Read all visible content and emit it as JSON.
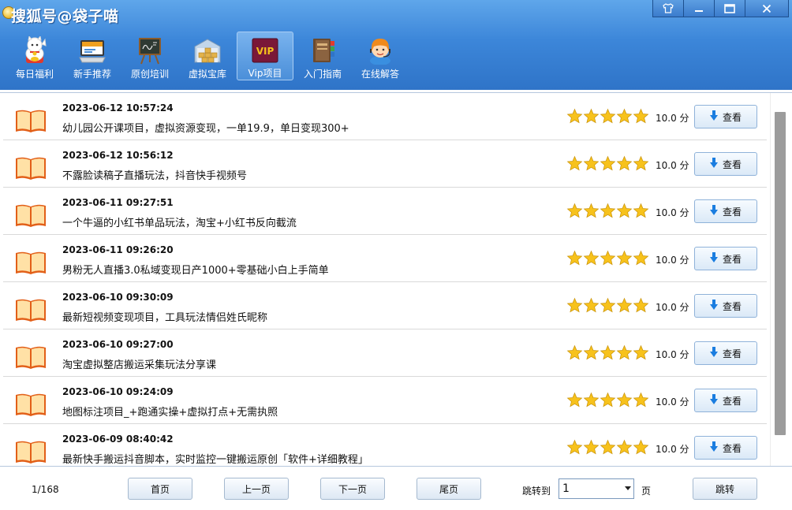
{
  "app": {
    "title": "搜狐号@袋子喵",
    "window_controls": [
      "skin-icon",
      "minimize-icon",
      "maximize-icon",
      "close-icon"
    ]
  },
  "toolbar": {
    "items": [
      {
        "label": "每日福利",
        "icon": "lucky-cat-icon"
      },
      {
        "label": "新手推荐",
        "icon": "monitor-icon"
      },
      {
        "label": "原创培训",
        "icon": "chalkboard-icon"
      },
      {
        "label": "虚拟宝库",
        "icon": "warehouse-icon"
      },
      {
        "label": "Vip项目",
        "icon": "vip-icon",
        "active": true
      },
      {
        "label": "入门指南",
        "icon": "books-icon"
      },
      {
        "label": "在线解答",
        "icon": "support-agent-icon"
      }
    ],
    "vip_badge": "VIP"
  },
  "list": {
    "view_label": "查看",
    "score_unit": "分",
    "items": [
      {
        "date": "2023-06-12 10:57:24",
        "title": "幼儿园公开课项目，虚拟资源变现，一单19.9，单日变现300+",
        "score": "10.0",
        "stars": 5
      },
      {
        "date": "2023-06-12 10:56:12",
        "title": "不露脸读稿子直播玩法，抖音快手视频号",
        "score": "10.0",
        "stars": 5
      },
      {
        "date": "2023-06-11 09:27:51",
        "title": "一个牛逼的小红书单品玩法，淘宝+小红书反向截流",
        "score": "10.0",
        "stars": 5
      },
      {
        "date": "2023-06-11 09:26:20",
        "title": "男粉无人直播3.0私域变现日产1000+零基础小白上手简单",
        "score": "10.0",
        "stars": 5
      },
      {
        "date": "2023-06-10 09:30:09",
        "title": "最新短视频变现项目，工具玩法情侣姓氏昵称",
        "score": "10.0",
        "stars": 5
      },
      {
        "date": "2023-06-10 09:27:00",
        "title": "淘宝虚拟整店搬运采集玩法分享课",
        "score": "10.0",
        "stars": 5
      },
      {
        "date": "2023-06-10 09:24:09",
        "title": "地图标注项目_+跑通实操+虚拟打点+无需执照",
        "score": "10.0",
        "stars": 5
      },
      {
        "date": "2023-06-09 08:40:42",
        "title": "最新快手搬运抖音脚本，实时监控一键搬运原创「软件+详细教程」",
        "score": "10.0",
        "stars": 5
      }
    ]
  },
  "pagination": {
    "page_count": "1/168",
    "first": "首页",
    "prev": "上一页",
    "next": "下一页",
    "last": "尾页",
    "jump_to": "跳转到",
    "page_value": "1",
    "page_unit": "页",
    "jump": "跳转"
  },
  "colors": {
    "header_top": "#5fa6ea",
    "header_bottom": "#2f74c8",
    "star": "#f7c21c",
    "download_arrow": "#1a7de0"
  }
}
